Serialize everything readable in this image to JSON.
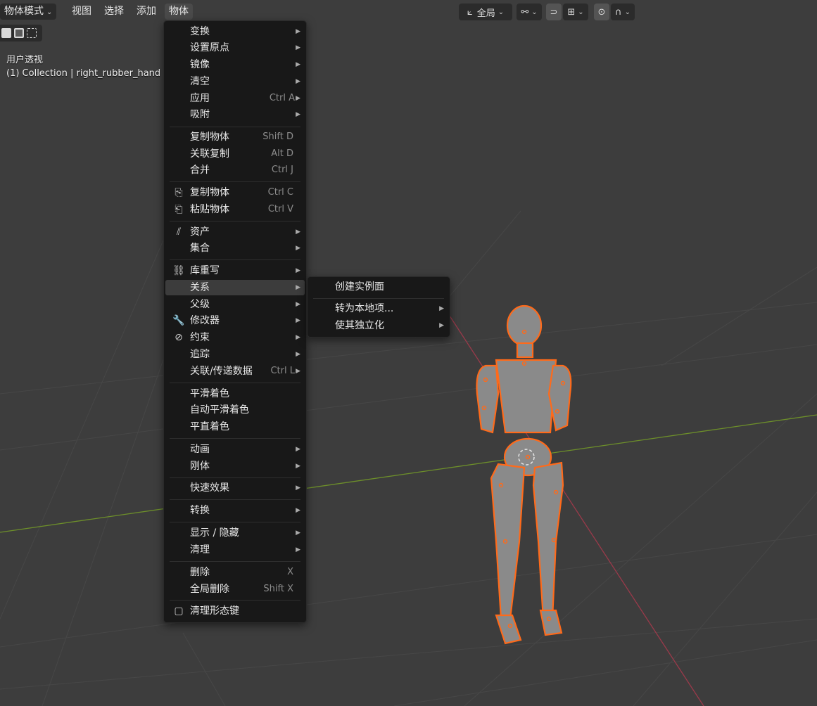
{
  "header": {
    "mode": "物体模式",
    "menus": [
      "视图",
      "选择",
      "添加",
      "物体"
    ],
    "orientation": "全局"
  },
  "viewport": {
    "view_name": "用户透视",
    "collection_info": "(1) Collection | right_rubber_hand"
  },
  "object_menu": {
    "items": [
      {
        "label": "变换",
        "shortcut": "",
        "submenu": true,
        "icon": ""
      },
      {
        "label": "设置原点",
        "shortcut": "",
        "submenu": true,
        "icon": ""
      },
      {
        "label": "镜像",
        "shortcut": "",
        "submenu": true,
        "icon": ""
      },
      {
        "label": "清空",
        "shortcut": "",
        "submenu": true,
        "icon": ""
      },
      {
        "label": "应用",
        "shortcut": "Ctrl A",
        "submenu": true,
        "icon": ""
      },
      {
        "label": "吸附",
        "shortcut": "",
        "submenu": true,
        "icon": ""
      },
      {
        "label": "复制物体",
        "shortcut": "Shift D",
        "submenu": false,
        "icon": ""
      },
      {
        "label": "关联复制",
        "shortcut": "Alt D",
        "submenu": false,
        "icon": ""
      },
      {
        "label": "合并",
        "shortcut": "Ctrl J",
        "submenu": false,
        "icon": ""
      },
      {
        "label": "复制物体",
        "shortcut": "Ctrl C",
        "submenu": false,
        "icon": "copy-icon"
      },
      {
        "label": "粘贴物体",
        "shortcut": "Ctrl V",
        "submenu": false,
        "icon": "paste-icon"
      },
      {
        "label": "资产",
        "shortcut": "",
        "submenu": true,
        "icon": "asset-icon"
      },
      {
        "label": "集合",
        "shortcut": "",
        "submenu": true,
        "icon": ""
      },
      {
        "label": "库重写",
        "shortcut": "",
        "submenu": true,
        "icon": "library-override-icon"
      },
      {
        "label": "关系",
        "shortcut": "",
        "submenu": true,
        "icon": ""
      },
      {
        "label": "父级",
        "shortcut": "",
        "submenu": true,
        "icon": ""
      },
      {
        "label": "修改器",
        "shortcut": "",
        "submenu": true,
        "icon": "wrench-icon"
      },
      {
        "label": "约束",
        "shortcut": "",
        "submenu": true,
        "icon": "constraint-icon"
      },
      {
        "label": "追踪",
        "shortcut": "",
        "submenu": true,
        "icon": ""
      },
      {
        "label": "关联/传递数据",
        "shortcut": "Ctrl L",
        "submenu": true,
        "icon": ""
      },
      {
        "label": "平滑着色",
        "shortcut": "",
        "submenu": false,
        "icon": ""
      },
      {
        "label": "自动平滑着色",
        "shortcut": "",
        "submenu": false,
        "icon": ""
      },
      {
        "label": "平直着色",
        "shortcut": "",
        "submenu": false,
        "icon": ""
      },
      {
        "label": "动画",
        "shortcut": "",
        "submenu": true,
        "icon": ""
      },
      {
        "label": "刚体",
        "shortcut": "",
        "submenu": true,
        "icon": ""
      },
      {
        "label": "快速效果",
        "shortcut": "",
        "submenu": true,
        "icon": ""
      },
      {
        "label": "转换",
        "shortcut": "",
        "submenu": true,
        "icon": ""
      },
      {
        "label": "显示 / 隐藏",
        "shortcut": "",
        "submenu": true,
        "icon": ""
      },
      {
        "label": "清理",
        "shortcut": "",
        "submenu": true,
        "icon": ""
      },
      {
        "label": "删除",
        "shortcut": "X",
        "submenu": false,
        "icon": ""
      },
      {
        "label": "全局删除",
        "shortcut": "Shift X",
        "submenu": false,
        "icon": ""
      },
      {
        "label": "清理形态键",
        "shortcut": "",
        "submenu": false,
        "icon": "shape-key-icon"
      }
    ]
  },
  "relations_submenu": {
    "items": [
      {
        "label": "创建实例面",
        "submenu": false
      },
      {
        "label": "转为本地项...",
        "submenu": true
      },
      {
        "label": "使其独立化",
        "submenu": true
      }
    ]
  },
  "colors": {
    "background": "#3d3d3d",
    "menu": "#181818",
    "highlight": "#3c3c3c",
    "selection_outline": "#ff6a1a",
    "x_axis": "#9a3a4a",
    "y_axis": "#6d8f2a"
  }
}
